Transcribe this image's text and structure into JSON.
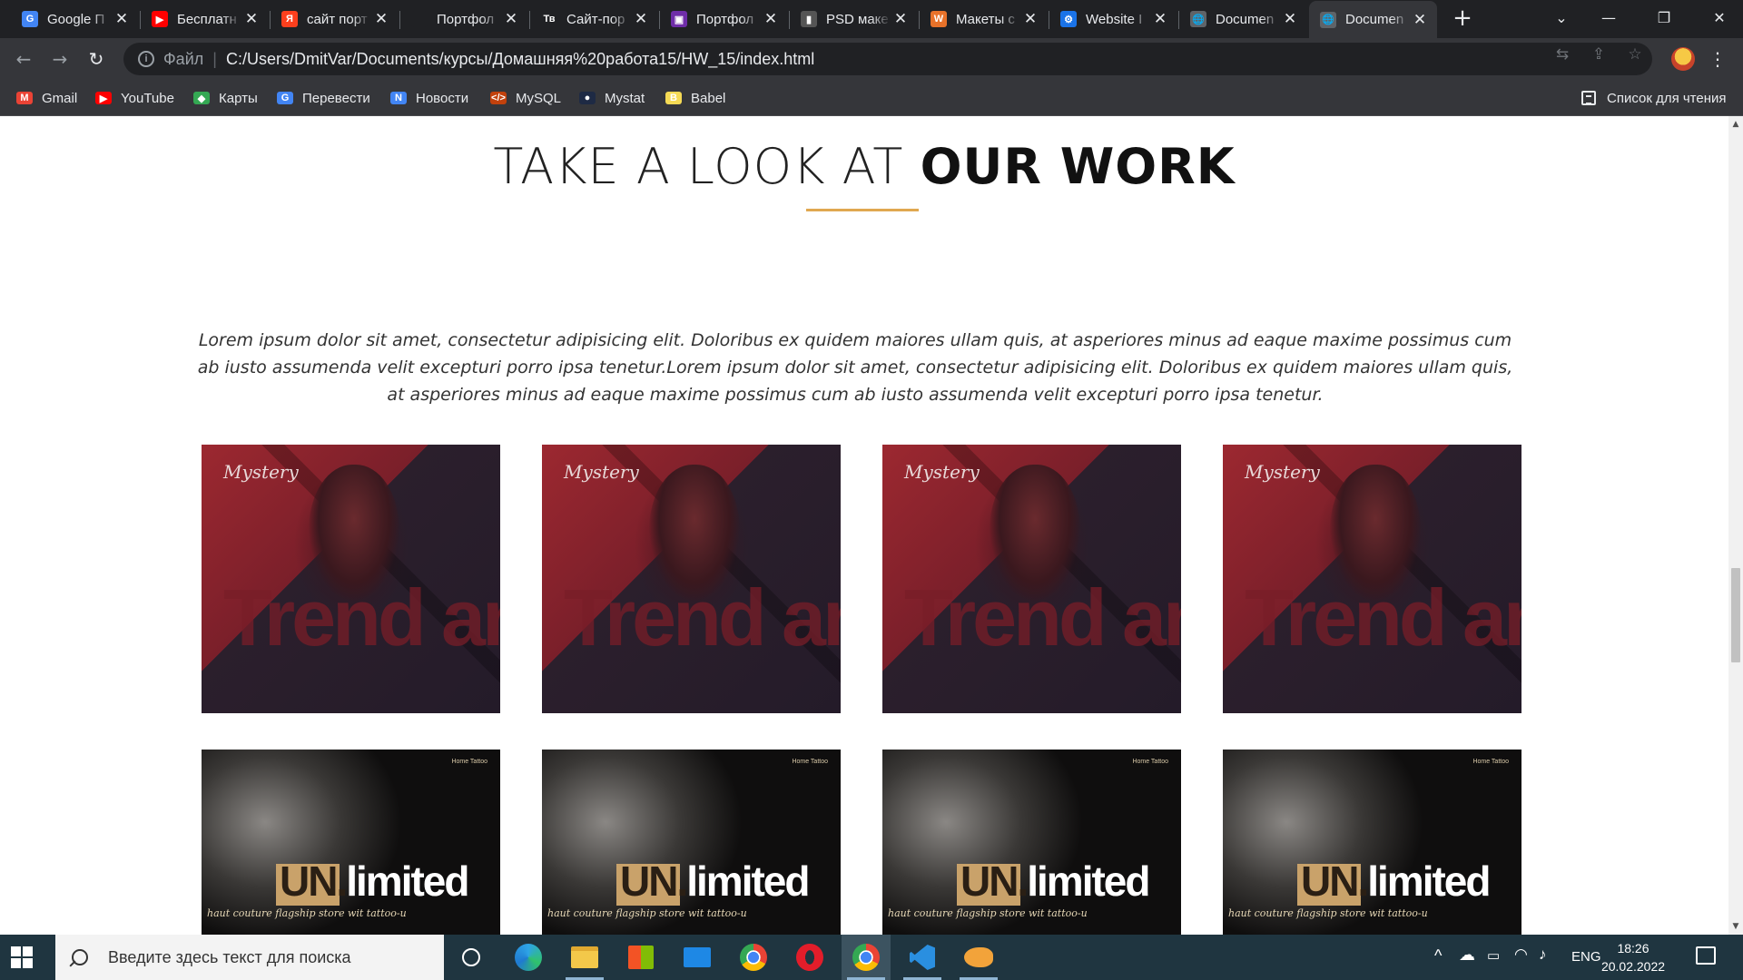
{
  "tabs": [
    {
      "title": "Google П",
      "fav_color": "#4285f4",
      "fav_glyph": "G",
      "icon": "google-translate-icon"
    },
    {
      "title": "Бесплатн",
      "fav_color": "#ff0000",
      "fav_glyph": "▶",
      "icon": "youtube-icon"
    },
    {
      "title": "сайт порт",
      "fav_color": "#fc3f1d",
      "fav_glyph": "Я",
      "icon": "yandex-icon"
    },
    {
      "title": "Портфол",
      "fav_color": "#202124",
      "fav_glyph": "",
      "icon": "blank-icon"
    },
    {
      "title": "Сайт-пор",
      "fav_color": "#202124",
      "fav_glyph": "Тв",
      "icon": "tilda-icon"
    },
    {
      "title": "Портфол",
      "fav_color": "#6f2da8",
      "fav_glyph": "▣",
      "icon": "twitch-icon"
    },
    {
      "title": "PSD маке",
      "fav_color": "#555555",
      "fav_glyph": "▮",
      "icon": "psd-icon"
    },
    {
      "title": "Макеты с",
      "fav_color": "#e8722a",
      "fav_glyph": "W",
      "icon": "site-icon"
    },
    {
      "title": "Website I",
      "fav_color": "#1a73e8",
      "fav_glyph": "⚙",
      "icon": "website-icon"
    },
    {
      "title": "Documen",
      "fav_color": "#5f6368",
      "fav_glyph": "🌐",
      "icon": "globe-icon"
    },
    {
      "title": "Documen",
      "fav_color": "#5f6368",
      "fav_glyph": "🌐",
      "icon": "globe-icon",
      "active": true
    }
  ],
  "toolbar": {
    "scheme": "Файл",
    "url": "C:/Users/DmitVar/Documents/курсы/Домашняя%20работа15/HW_15/index.html"
  },
  "bookmarks": [
    {
      "label": "Gmail",
      "color": "#ea4335",
      "glyph": "M"
    },
    {
      "label": "YouTube",
      "color": "#ff0000",
      "glyph": "▶"
    },
    {
      "label": "Карты",
      "color": "#34a853",
      "glyph": "◆"
    },
    {
      "label": "Перевести",
      "color": "#4285f4",
      "glyph": "G"
    },
    {
      "label": "Новости",
      "color": "#4285f4",
      "glyph": "N"
    },
    {
      "label": "MySQL",
      "color": "#c2410c",
      "glyph": "</>"
    },
    {
      "label": "Mystat",
      "color": "#1e2a44",
      "glyph": "●"
    },
    {
      "label": "Babel",
      "color": "#f5da55",
      "glyph": "B"
    }
  ],
  "reading_list": "Список для чтения",
  "page": {
    "title_thin": "TAKE A LOOK AT ",
    "title_bold": "OUR WORK",
    "accent_color": "#e0a850",
    "lead": "Lorem ipsum dolor sit amet, consectetur adipisicing elit. Doloribus ex quidem maiores ullam quis, at asperiores minus ad eaque maxime possimus cum ab iusto assumenda velit excepturi porro ipsa tenetur.Lorem ipsum dolor sit amet, consectetur adipisicing elit. Doloribus ex quidem maiores ullam quis, at asperiores minus ad eaque maxime possimus cum ab iusto assumenda velit excepturi porro ipsa tenetur.",
    "mystery_card": {
      "brand": "Mystery",
      "headline": "Trend an"
    },
    "unlimited_card": {
      "menu": "Home   Tattoo",
      "logo_un": "UN.",
      "logo_rest": "limited",
      "tagline": "haut couture flagship store wit tattoo-u"
    }
  },
  "taskbar": {
    "search_placeholder": "Введите здесь текст для поиска",
    "language": "ENG",
    "time": "18:26",
    "date": "20.02.2022"
  }
}
